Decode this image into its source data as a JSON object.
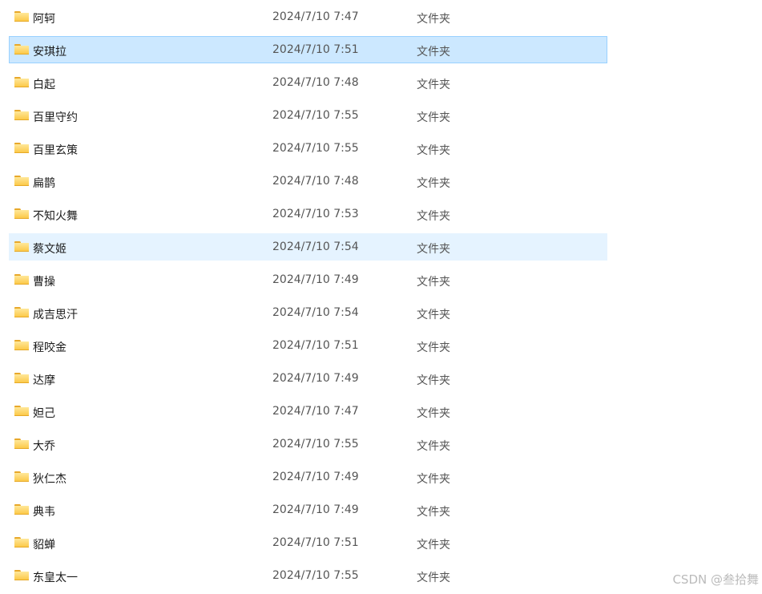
{
  "files": [
    {
      "name": "阿轲",
      "date": "2024/7/10 7:47",
      "type": "文件夹"
    },
    {
      "name": "安琪拉",
      "date": "2024/7/10 7:51",
      "type": "文件夹",
      "state": "selected"
    },
    {
      "name": "白起",
      "date": "2024/7/10 7:48",
      "type": "文件夹"
    },
    {
      "name": "百里守约",
      "date": "2024/7/10 7:55",
      "type": "文件夹"
    },
    {
      "name": "百里玄策",
      "date": "2024/7/10 7:55",
      "type": "文件夹"
    },
    {
      "name": "扁鹊",
      "date": "2024/7/10 7:48",
      "type": "文件夹"
    },
    {
      "name": "不知火舞",
      "date": "2024/7/10 7:53",
      "type": "文件夹"
    },
    {
      "name": "蔡文姬",
      "date": "2024/7/10 7:54",
      "type": "文件夹",
      "state": "hover"
    },
    {
      "name": "曹操",
      "date": "2024/7/10 7:49",
      "type": "文件夹"
    },
    {
      "name": "成吉思汗",
      "date": "2024/7/10 7:54",
      "type": "文件夹"
    },
    {
      "name": "程咬金",
      "date": "2024/7/10 7:51",
      "type": "文件夹"
    },
    {
      "name": "达摩",
      "date": "2024/7/10 7:49",
      "type": "文件夹"
    },
    {
      "name": "妲己",
      "date": "2024/7/10 7:47",
      "type": "文件夹"
    },
    {
      "name": "大乔",
      "date": "2024/7/10 7:55",
      "type": "文件夹"
    },
    {
      "name": "狄仁杰",
      "date": "2024/7/10 7:49",
      "type": "文件夹"
    },
    {
      "name": "典韦",
      "date": "2024/7/10 7:49",
      "type": "文件夹"
    },
    {
      "name": "貂蝉",
      "date": "2024/7/10 7:51",
      "type": "文件夹"
    },
    {
      "name": "东皇太一",
      "date": "2024/7/10 7:55",
      "type": "文件夹"
    }
  ],
  "watermark": "CSDN @叁拾舞",
  "icon": "folder-icon",
  "colors": {
    "selected_bg": "#cce8ff",
    "selected_border": "#99d1ff",
    "hover_bg": "#e5f3ff"
  }
}
